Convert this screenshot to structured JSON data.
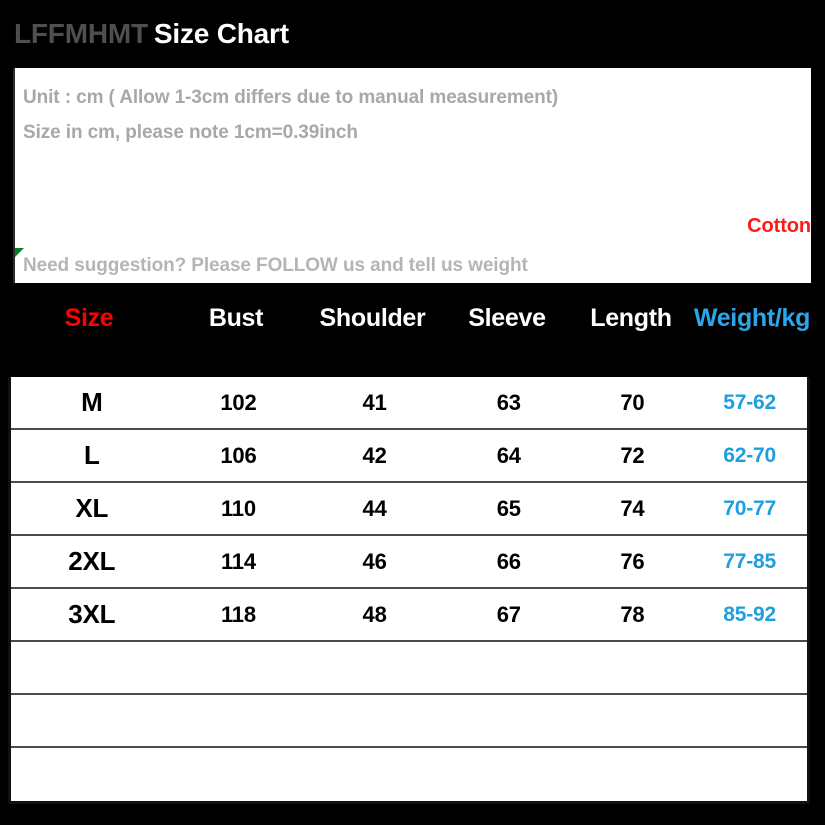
{
  "header": {
    "brand": "LFFMHMT",
    "title": "Size Chart"
  },
  "info": {
    "line1": "Unit : cm ( Allow 1-3cm differs due to manual measurement)",
    "line2": "Size in cm, please note 1cm=0.39inch",
    "material": "Cotton",
    "follow_note": "Need suggestion? Please FOLLOW us and tell us weight",
    "marker_icon": "green-comment-triangle-icon"
  },
  "colors": {
    "size_header": "#ff0000",
    "weight_header": "#2aa7e8",
    "weight_value": "#1f9fe0",
    "material": "#ff1a1a",
    "info_text": "#a8a8a8",
    "background": "#000000",
    "panel": "#ffffff"
  },
  "chart_data": {
    "type": "table",
    "title": "Size Chart",
    "columns": [
      "Size",
      "Bust",
      "Shoulder",
      "Sleeve",
      "Length",
      "Weight/kg"
    ],
    "units": "cm",
    "rows": [
      {
        "size": "M",
        "bust": "102",
        "shoulder": "41",
        "sleeve": "63",
        "length": "70",
        "weight": "57-62"
      },
      {
        "size": "L",
        "bust": "106",
        "shoulder": "42",
        "sleeve": "64",
        "length": "72",
        "weight": "62-70"
      },
      {
        "size": "XL",
        "bust": "110",
        "shoulder": "44",
        "sleeve": "65",
        "length": "74",
        "weight": "70-77"
      },
      {
        "size": "2XL",
        "bust": "114",
        "shoulder": "46",
        "sleeve": "66",
        "length": "76",
        "weight": "77-85"
      },
      {
        "size": "3XL",
        "bust": "118",
        "shoulder": "48",
        "sleeve": "67",
        "length": "78",
        "weight": "85-92"
      },
      {
        "size": "",
        "bust": "",
        "shoulder": "",
        "sleeve": "",
        "length": "",
        "weight": ""
      },
      {
        "size": "",
        "bust": "",
        "shoulder": "",
        "sleeve": "",
        "length": "",
        "weight": ""
      },
      {
        "size": "",
        "bust": "",
        "shoulder": "",
        "sleeve": "",
        "length": "",
        "weight": ""
      }
    ]
  }
}
